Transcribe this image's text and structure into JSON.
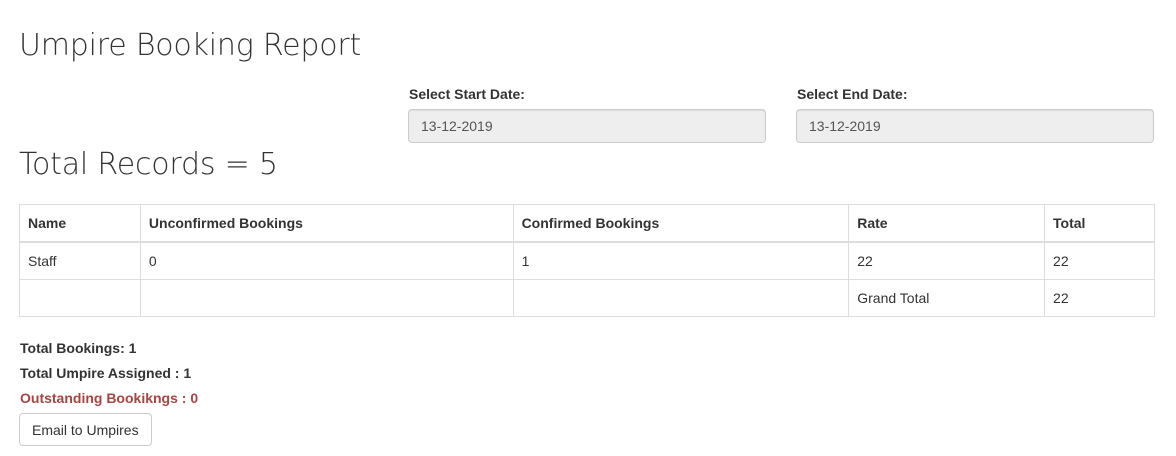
{
  "page": {
    "title": "Umpire Booking Report"
  },
  "filters": {
    "start_label": "Select Start Date:",
    "start_value": "13-12-2019",
    "end_label": "Select End Date:",
    "end_value": "13-12-2019"
  },
  "records": {
    "heading": "Total Records = 5"
  },
  "table": {
    "headers": [
      "Name",
      "Unconfirmed Bookings",
      "Confirmed Bookings",
      "Rate",
      "Total"
    ],
    "rows": [
      [
        "Staff",
        "0",
        "1",
        "22",
        "22"
      ],
      [
        "",
        "",
        "",
        "Grand Total",
        "22"
      ]
    ]
  },
  "summary": {
    "total_bookings": "Total Bookings: 1",
    "total_umpire_assigned": "Total Umpire Assigned : 1",
    "outstanding": "Outstanding Bookikngs : 0"
  },
  "actions": {
    "email_label": "Email to Umpires"
  },
  "colors": {
    "outstanding": "#a94442",
    "input_background": "#eeeeee"
  }
}
